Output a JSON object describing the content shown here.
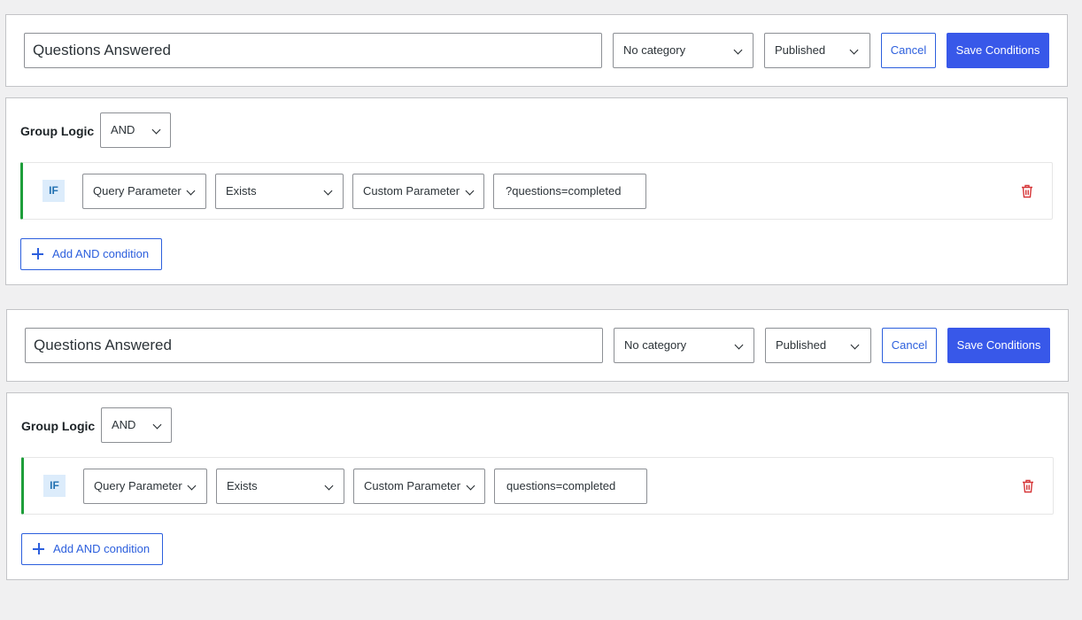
{
  "blocks": [
    {
      "title": "Questions Answered",
      "category": "No category",
      "status": "Published",
      "cancel_label": "Cancel",
      "save_label": "Save Conditions",
      "group_logic_label": "Group Logic",
      "group_logic_value": "AND",
      "condition": {
        "badge": "IF",
        "type": "Query Parameter",
        "operator": "Exists",
        "param_type": "Custom Parameter",
        "value": "?questions=completed"
      },
      "add_label": "Add AND condition"
    },
    {
      "title": "Questions Answered",
      "category": "No category",
      "status": "Published",
      "cancel_label": "Cancel",
      "save_label": "Save Conditions",
      "group_logic_label": "Group Logic",
      "group_logic_value": "AND",
      "condition": {
        "badge": "IF",
        "type": "Query Parameter",
        "operator": "Exists",
        "param_type": "Custom Parameter",
        "value": "questions=completed"
      },
      "add_label": "Add AND condition"
    }
  ],
  "colors": {
    "primary": "#3858e9",
    "link": "#2c5fdd",
    "delete": "#d63638",
    "condition_accent": "#1e9e3a"
  },
  "icons": {
    "chevron": "chevron-down-icon",
    "delete": "trash-icon",
    "add": "plus-icon"
  }
}
